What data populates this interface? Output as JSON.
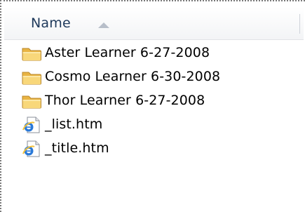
{
  "header": {
    "name_label": "Name",
    "sort_icon": "sort-ascending-icon"
  },
  "items": [
    {
      "label": "Aster Learner 6-27-2008",
      "icon": "folder-icon",
      "type": "folder"
    },
    {
      "label": "Cosmo Learner 6-30-2008",
      "icon": "folder-icon",
      "type": "folder"
    },
    {
      "label": "Thor Learner 6-27-2008",
      "icon": "folder-icon",
      "type": "folder"
    },
    {
      "label": "_list.htm",
      "icon": "ie-html-file-icon",
      "type": "file"
    },
    {
      "label": "_title.htm",
      "icon": "ie-html-file-icon",
      "type": "file"
    }
  ],
  "colors": {
    "header_text": "#1e395b",
    "folder": "#f3c35a",
    "ie_blue": "#1a66c9"
  }
}
